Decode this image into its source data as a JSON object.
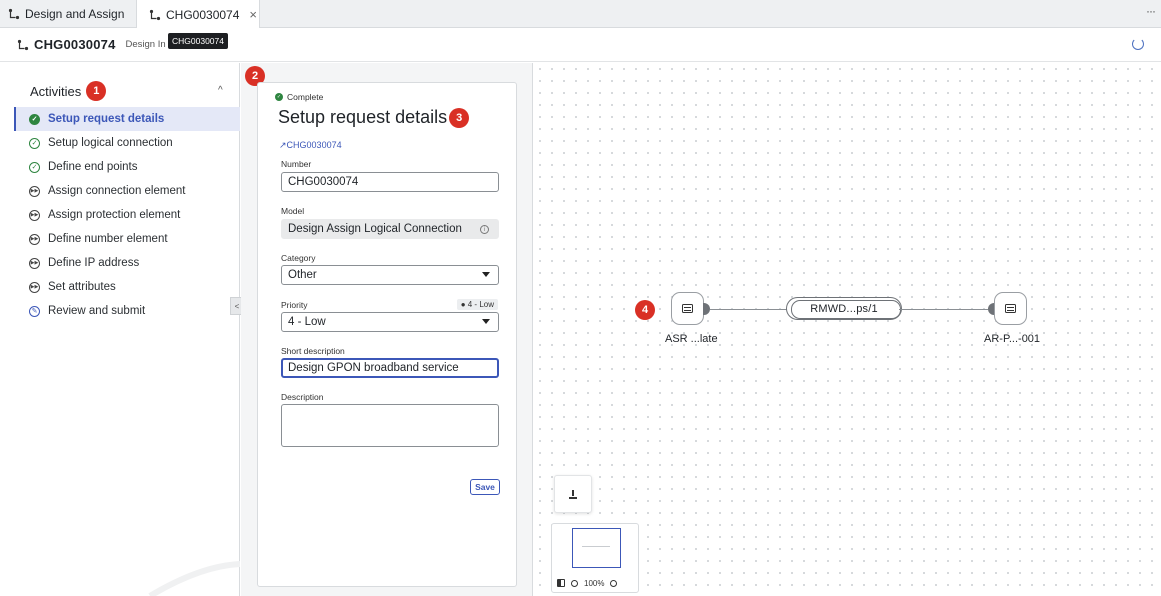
{
  "tabs": [
    {
      "label": "Design and Assign"
    },
    {
      "label": "CHG0030074",
      "close": "×"
    }
  ],
  "tab_more": "···",
  "header": {
    "title": "CHG0030074",
    "subtitle": "Design In Pr",
    "tooltip": "CHG0030074"
  },
  "activities": {
    "heading": "Activities",
    "badge": "1",
    "collapse_glyph": "^",
    "items": [
      {
        "label": "Setup request details",
        "state": "complete",
        "selected": true
      },
      {
        "label": "Setup logical connection",
        "state": "done"
      },
      {
        "label": "Define end points",
        "state": "done"
      },
      {
        "label": "Assign connection element",
        "state": "skipped"
      },
      {
        "label": "Assign protection element",
        "state": "skipped"
      },
      {
        "label": "Define number element",
        "state": "skipped"
      },
      {
        "label": "Define IP address",
        "state": "skipped"
      },
      {
        "label": "Set attributes",
        "state": "skipped"
      },
      {
        "label": "Review and submit",
        "state": "pending"
      }
    ],
    "collapse_tab": "<"
  },
  "form": {
    "badge": "2",
    "status": "Complete",
    "title": "Setup request details",
    "title_badge": "3",
    "ref_link": "CHG0030074",
    "fields": {
      "number": {
        "label": "Number",
        "value": "CHG0030074"
      },
      "model": {
        "label": "Model",
        "value": "Design Assign Logical Connection"
      },
      "category": {
        "label": "Category",
        "value": "Other"
      },
      "priority": {
        "label": "Priority",
        "value": "4 - Low",
        "pill": "● 4 - Low"
      },
      "short_description": {
        "label": "Short description",
        "value": "Design GPON broadband service"
      },
      "description": {
        "label": "Description",
        "value": ""
      }
    },
    "save_label": "Save"
  },
  "canvas": {
    "badge": "4",
    "node_a_label": "ASR ...late",
    "link_label": "RMWD...ps/1",
    "node_b_label": "AR-P...-001",
    "zoom": "100%"
  }
}
